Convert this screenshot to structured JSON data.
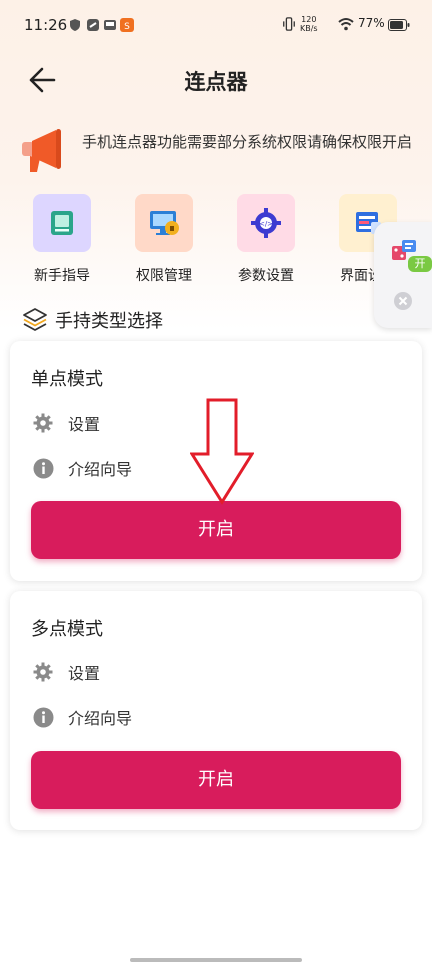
{
  "status_bar": {
    "time": "11:26",
    "net_speed_top": "120",
    "net_speed_bottom": "KB/s",
    "battery": "77%"
  },
  "header": {
    "title": "连点器"
  },
  "notice": {
    "text": "手机连点器功能需要部分系统权限请确保权限开启"
  },
  "quick": [
    {
      "label": "新手指导",
      "bg": "#ddd6ff",
      "icon": "guide-book-icon"
    },
    {
      "label": "权限管理",
      "bg": "#ffd9c8",
      "icon": "permission-monitor-icon"
    },
    {
      "label": "参数设置",
      "bg": "#ffdbe6",
      "icon": "parameter-gear-icon"
    },
    {
      "label": "界面设置",
      "bg": "#fff0d0",
      "icon": "interface-layout-icon"
    }
  ],
  "floating": {
    "badge": "开"
  },
  "section": {
    "title": "手持类型选择"
  },
  "cards": [
    {
      "title": "单点模式",
      "settings": "设置",
      "guide": "介绍向导",
      "button": "开启"
    },
    {
      "title": "多点模式",
      "settings": "设置",
      "guide": "介绍向导",
      "button": "开启"
    }
  ],
  "colors": {
    "accent": "#d81c5c",
    "notice_orange": "#f05a28"
  }
}
